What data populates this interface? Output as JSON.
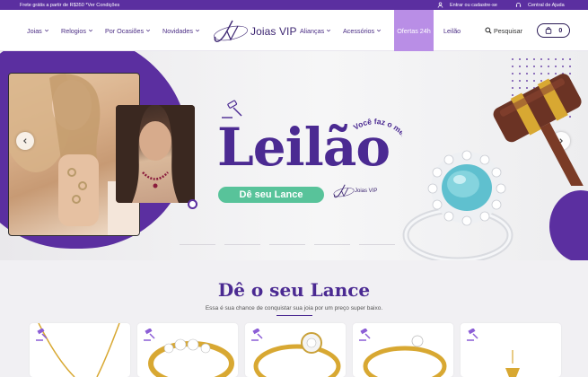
{
  "topbar": {
    "promo": "Frete grátis a partir de R$350 *Ver Condições",
    "login": "Entrar ou cadastre-se",
    "help": "Central de Ajuda"
  },
  "nav": {
    "items": [
      {
        "label": "Joias",
        "dropdown": true
      },
      {
        "label": "Relogios",
        "dropdown": true
      },
      {
        "label": "Por Ocasiões",
        "dropdown": true
      },
      {
        "label": "Novidades",
        "dropdown": true
      }
    ],
    "items_right": [
      {
        "label": "Alianças",
        "dropdown": true
      },
      {
        "label": "Acessórios",
        "dropdown": true
      },
      {
        "label": "Ofertas 24h",
        "dropdown": false
      },
      {
        "label": "Leilão",
        "dropdown": false
      }
    ],
    "search": "Pesquisar",
    "cart_count": "0"
  },
  "logo": {
    "mark": "jv",
    "brand": "Joias VIP"
  },
  "hero": {
    "title": "Leilão",
    "cta": "Dê seu Lance",
    "curved_tagline": "Você faz o melhor preço",
    "small_logo_brand": "Joias VIP"
  },
  "section": {
    "title": "Dê o seu Lance",
    "subtitle": "Essa é sua chance de conquistar sua joia por um preço super baixo."
  },
  "colors": {
    "brand_purple": "#5b2fa0",
    "title_purple": "#4b2a92",
    "accent_green": "#58c39a",
    "offers_lilac": "#b98ee6"
  },
  "products_count": 5
}
